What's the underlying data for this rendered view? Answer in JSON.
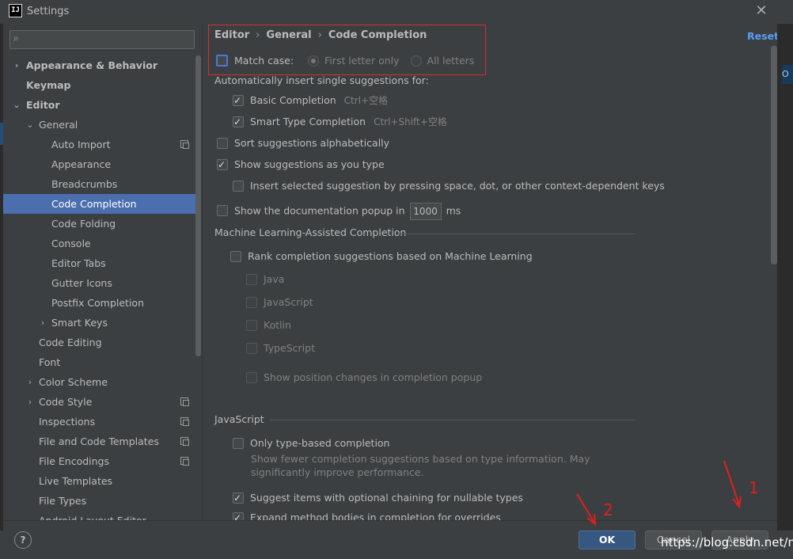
{
  "window": {
    "title": "Settings",
    "app_icon": "IJ"
  },
  "search": {
    "placeholder": ""
  },
  "sidebar": {
    "items": [
      {
        "label": "Appearance & Behavior"
      },
      {
        "label": "Keymap"
      },
      {
        "label": "Editor"
      },
      {
        "label": "General"
      },
      {
        "label": "Auto Import"
      },
      {
        "label": "Appearance"
      },
      {
        "label": "Breadcrumbs"
      },
      {
        "label": "Code Completion"
      },
      {
        "label": "Code Folding"
      },
      {
        "label": "Console"
      },
      {
        "label": "Editor Tabs"
      },
      {
        "label": "Gutter Icons"
      },
      {
        "label": "Postfix Completion"
      },
      {
        "label": "Smart Keys"
      },
      {
        "label": "Code Editing"
      },
      {
        "label": "Font"
      },
      {
        "label": "Color Scheme"
      },
      {
        "label": "Code Style"
      },
      {
        "label": "Inspections"
      },
      {
        "label": "File and Code Templates"
      },
      {
        "label": "File Encodings"
      },
      {
        "label": "Live Templates"
      },
      {
        "label": "File Types"
      },
      {
        "label": "Android Layout Editor"
      }
    ]
  },
  "main": {
    "breadcrumb": [
      "Editor",
      "General",
      "Code Completion"
    ],
    "reset": "Reset",
    "match_case": "Match case:",
    "radio_first": "First letter only",
    "radio_all": "All letters",
    "auto_insert": "Automatically insert single suggestions for:",
    "basic": "Basic Completion",
    "basic_shortcut": "Ctrl+空格",
    "smart": "Smart Type Completion",
    "smart_shortcut": "Ctrl+Shift+空格",
    "sort": "Sort suggestions alphabetically",
    "show_as_type": "Show suggestions as you type",
    "insert_selected": "Insert selected suggestion by pressing space, dot, or other context-dependent keys",
    "doc_popup": "Show the documentation popup in",
    "doc_ms_value": "1000",
    "doc_ms_unit": "ms",
    "ml_section": "Machine Learning-Assisted Completion",
    "ml_rank": "Rank completion suggestions based on Machine Learning",
    "ml_java": "Java",
    "ml_js": "JavaScript",
    "ml_kotlin": "Kotlin",
    "ml_ts": "TypeScript",
    "ml_show_pos": "Show position changes in completion popup",
    "js_section": "JavaScript",
    "js_type_based": "Only type-based completion",
    "js_desc_1": "Show fewer completion suggestions based on type information. May",
    "js_desc_2": "significantly improve performance.",
    "js_optional": "Suggest items with optional chaining for nullable types",
    "js_expand": "Expand method bodies in completion for overrides"
  },
  "footer": {
    "help": "?",
    "ok": "OK",
    "cancel": "Cancel",
    "apply": "Apply"
  },
  "annotations": {
    "one": "1",
    "two": "2"
  },
  "watermark": "https://blog.csdn.net/m",
  "outside": {
    "peek": "O"
  }
}
